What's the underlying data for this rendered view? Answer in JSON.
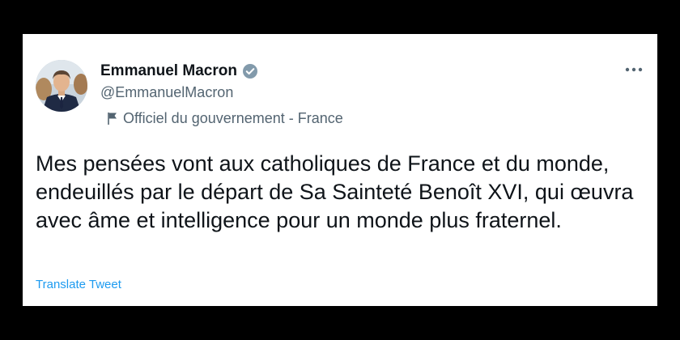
{
  "tweet": {
    "author": {
      "display_name": "Emmanuel Macron",
      "handle": "@EmmanuelMacron",
      "verified_icon": "verified-badge-icon",
      "affiliation_label": "Officiel du gouvernement - France",
      "affiliation_icon": "flag-icon"
    },
    "more_icon": "more-dots-icon",
    "text": "Mes pensées vont aux catholiques de France et du monde, endeuillés par le départ de Sa Sainteté Benoît XVI, qui œuvra avec âme et intelligence pour un monde plus fraternel.",
    "translate_label": "Translate Tweet"
  },
  "colors": {
    "background": "#000000",
    "card": "#ffffff",
    "text_primary": "#0f1419",
    "text_secondary": "#536471",
    "link": "#1d9bf0",
    "verified_badge": "#829aab"
  }
}
